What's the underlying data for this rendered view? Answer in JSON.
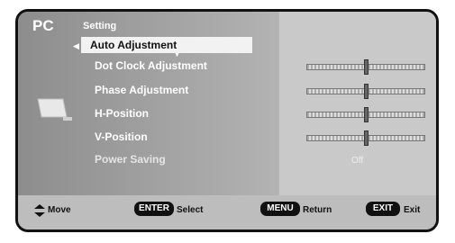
{
  "header": {
    "source": "PC",
    "section": "Setting"
  },
  "menu": {
    "items": [
      {
        "label": "Auto Adjustment"
      },
      {
        "label": "Dot Clock Adjustment"
      },
      {
        "label": "Phase Adjustment"
      },
      {
        "label": "H-Position"
      },
      {
        "label": "V-Position"
      },
      {
        "label": "Power Saving"
      }
    ]
  },
  "sliders": {
    "dot_clock": 0.5,
    "phase": 0.5,
    "h_position": 0.5,
    "v_position": 0.5
  },
  "power_saving_value": "Off",
  "footer": {
    "move": "Move",
    "enter_key": "ENTER",
    "select": "Select",
    "menu_key": "MENU",
    "return": "Return",
    "exit_key": "EXIT",
    "exit": "Exit"
  },
  "icons": {
    "nav": "up-down-arrow-icon",
    "left": "left-arrow-icon",
    "down": "down-arrow-icon",
    "monitor": "monitor-icon"
  }
}
